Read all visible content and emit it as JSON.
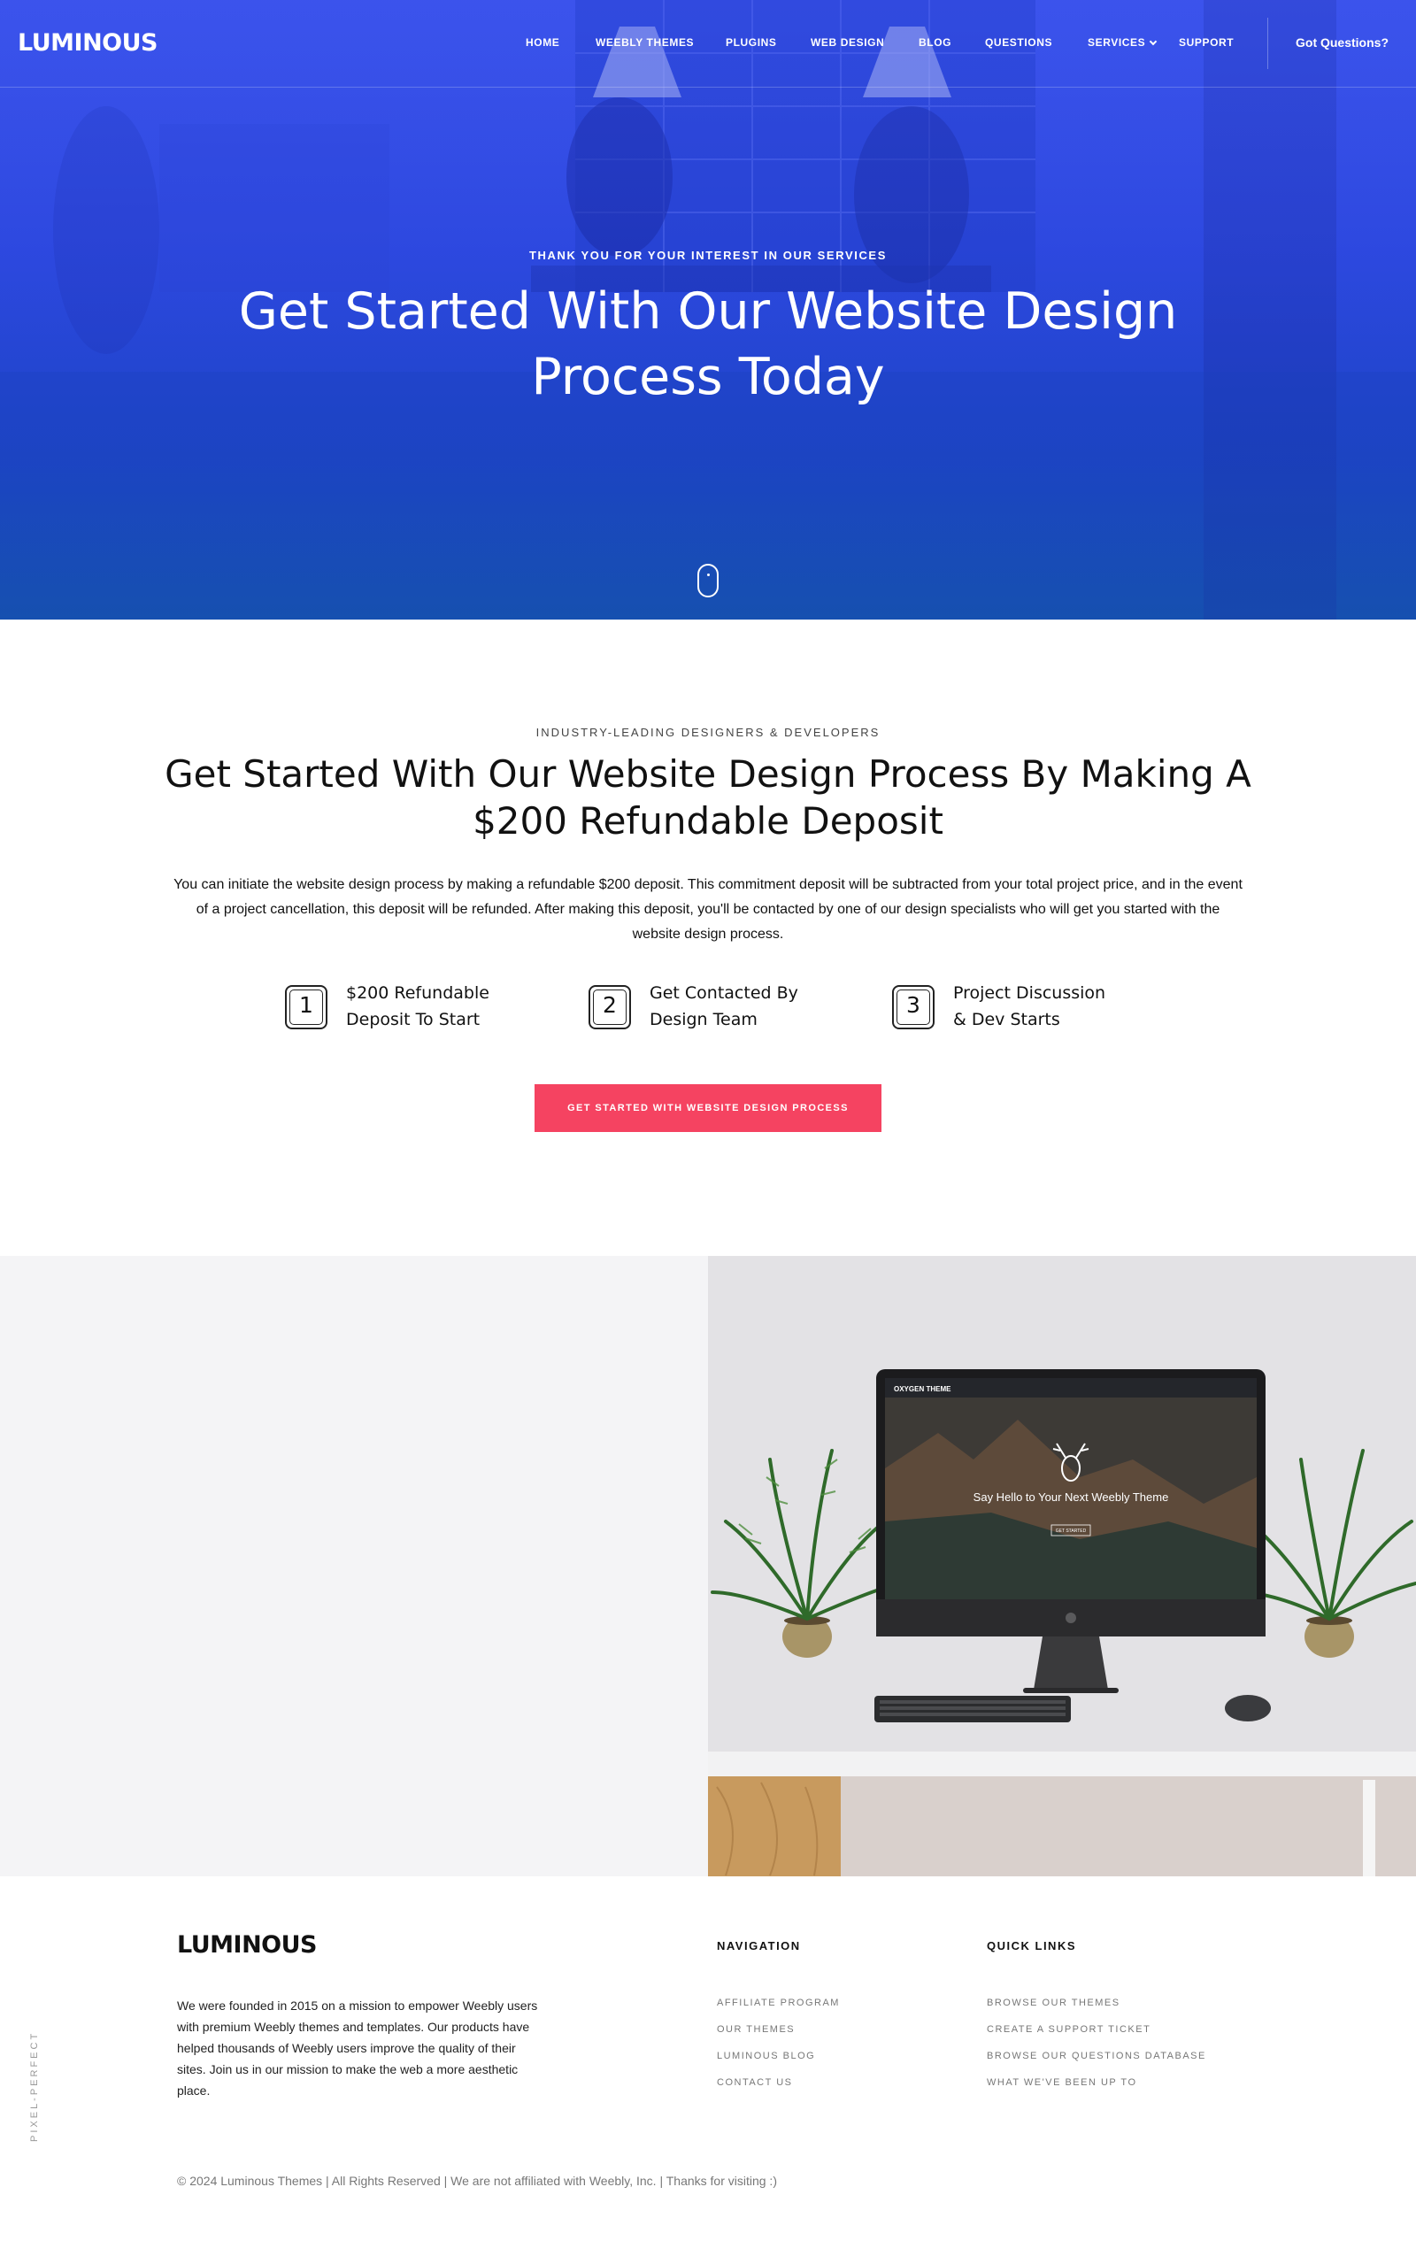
{
  "brand": {
    "logo_text": "LUMINOUS",
    "accent": "#f54361",
    "hero_blue": "#2d49e0"
  },
  "nav": {
    "items": [
      {
        "label": "HOME"
      },
      {
        "label": "WEEBLY THEMES"
      },
      {
        "label": "PLUGINS"
      },
      {
        "label": "WEB DESIGN"
      },
      {
        "label": "BLOG"
      },
      {
        "label": "QUESTIONS"
      },
      {
        "label": "SERVICES",
        "icon": "chevron-down-icon"
      },
      {
        "label": "SUPPORT"
      }
    ],
    "cta_label": "Got Questions?"
  },
  "hero": {
    "kicker": "THANK YOU FOR YOUR INTEREST IN OUR SERVICES",
    "title": "Get Started With Our Website Design Process Today",
    "scroll_icon": "mouse-scroll-icon"
  },
  "deposit": {
    "kicker": "INDUSTRY-LEADING DESIGNERS & DEVELOPERS",
    "title": "Get Started With Our Website Design Process By Making A $200 Refundable Deposit",
    "description": "You can initiate the website design process by making a refundable $200 deposit. This commitment deposit will be subtracted from your total project price, and in the event of a project cancellation, this deposit will be refunded. After making this deposit, you'll be contacted by one of our design specialists who will get you started with the website design process.",
    "steps": [
      {
        "number": "1",
        "line1": "$200 Refundable",
        "line2": "Deposit To Start"
      },
      {
        "number": "2",
        "line1": "Get Contacted By",
        "line2": "Design Team"
      },
      {
        "number": "3",
        "line1": "Project Discussion",
        "line2": "& Dev Starts"
      }
    ],
    "cta_label": "GET STARTED WITH WEBSITE DESIGN PROCESS"
  },
  "showcase": {
    "screen_brand": "OXYGEN THEME",
    "screen_headline": "Say Hello to Your Next Weebly Theme",
    "screen_button": "GET STARTED"
  },
  "footer": {
    "logo_text": "LUMINOUS",
    "about": "We were founded in 2015 on a mission to empower Weebly users with premium Weebly themes and templates. Our products have helped thousands of Weebly users improve the quality of their sites. Join us in our mission to make the web a more aesthetic place.",
    "navigation": {
      "heading": "NAVIGATION",
      "links": [
        "AFFILIATE PROGRAM",
        "OUR THEMES",
        "LUMINOUS BLOG",
        "CONTACT US"
      ]
    },
    "quick_links": {
      "heading": "QUICK LINKS",
      "links": [
        "BROWSE OUR THEMES",
        "CREATE A SUPPORT TICKET",
        "BROWSE OUR QUESTIONS DATABASE",
        "WHAT WE'VE BEEN UP TO"
      ]
    },
    "vertical_tag": "PIXEL-PERFECT",
    "copyright": "© 2024 Luminous Themes | All Rights Reserved | We are not affiliated with Weebly, Inc. | Thanks for visiting :)"
  }
}
